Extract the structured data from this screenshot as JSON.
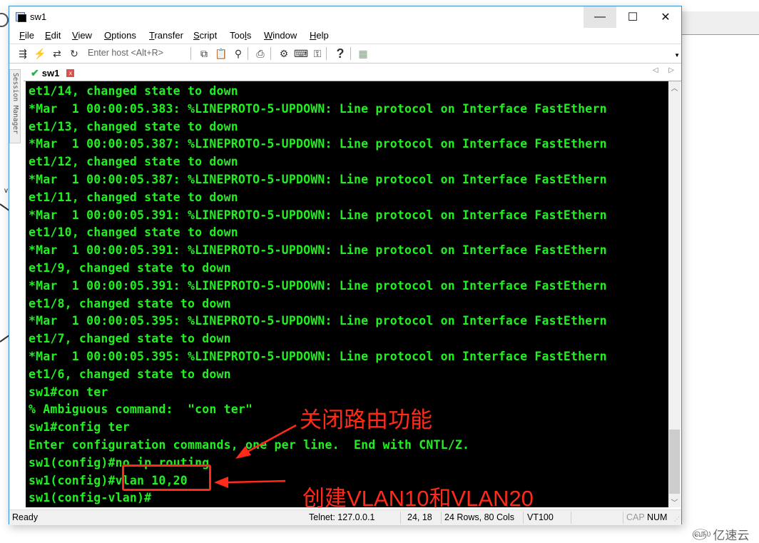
{
  "window": {
    "title": "sw1",
    "controls": {
      "minimize": "—",
      "maximize": "☐",
      "close": "✕"
    }
  },
  "menu": [
    {
      "label": "File",
      "accel": "F",
      "rest": "ile"
    },
    {
      "label": "Edit",
      "accel": "E",
      "rest": "dit"
    },
    {
      "label": "View",
      "accel": "V",
      "rest": "iew"
    },
    {
      "label": "Options",
      "accel": "O",
      "rest": "ptions"
    },
    {
      "label": "Transfer",
      "accel": "T",
      "rest": "ransfer"
    },
    {
      "label": "Script",
      "accel": "S",
      "rest": "cript"
    },
    {
      "label": "Tools",
      "pre": "Too",
      "accel": "l",
      "rest": "s"
    },
    {
      "label": "Window",
      "accel": "W",
      "rest": "indow"
    },
    {
      "label": "Help",
      "accel": "H",
      "rest": "elp"
    }
  ],
  "toolbar": {
    "host_placeholder": "Enter host <Alt+R>",
    "icons": {
      "connect": "⇶",
      "quick_connect": "⚡",
      "reconnect": "⇄",
      "disconnect": "↻",
      "copy": "⧉",
      "paste": "📋",
      "find": "⚲",
      "print": "⎙",
      "settings": "⚙",
      "keymap": "⌨",
      "key": "⚿",
      "help": "?",
      "sftp": "▦"
    }
  },
  "tabs": [
    {
      "label": "sw1",
      "status": "connected",
      "close": "x"
    }
  ],
  "tab_nav": "◁ ▷",
  "session_manager": "Session Manager",
  "terminal": {
    "lines": [
      "et1/14, changed state to down",
      "*Mar  1 00:00:05.383: %LINEPROTO-5-UPDOWN: Line protocol on Interface FastEthern",
      "et1/13, changed state to down",
      "*Mar  1 00:00:05.387: %LINEPROTO-5-UPDOWN: Line protocol on Interface FastEthern",
      "et1/12, changed state to down",
      "*Mar  1 00:00:05.387: %LINEPROTO-5-UPDOWN: Line protocol on Interface FastEthern",
      "et1/11, changed state to down",
      "*Mar  1 00:00:05.391: %LINEPROTO-5-UPDOWN: Line protocol on Interface FastEthern",
      "et1/10, changed state to down",
      "*Mar  1 00:00:05.391: %LINEPROTO-5-UPDOWN: Line protocol on Interface FastEthern",
      "et1/9, changed state to down",
      "*Mar  1 00:00:05.391: %LINEPROTO-5-UPDOWN: Line protocol on Interface FastEthern",
      "et1/8, changed state to down",
      "*Mar  1 00:00:05.395: %LINEPROTO-5-UPDOWN: Line protocol on Interface FastEthern",
      "et1/7, changed state to down",
      "*Mar  1 00:00:05.395: %LINEPROTO-5-UPDOWN: Line protocol on Interface FastEthern",
      "et1/6, changed state to down",
      "sw1#con ter",
      "% Ambiguous command:  \"con ter\"",
      "sw1#config ter",
      "Enter configuration commands, one per line.  End with CNTL/Z.",
      "sw1(config)#no ip routing",
      "sw1(config)#vlan 10,20",
      "sw1(config-vlan)#"
    ],
    "text_color": "#21f021",
    "background": "#000000",
    "scroll_position_fraction": 0.92
  },
  "annotations": {
    "label1": "关闭路由功能",
    "label2": "创建VLAN10和VLAN20",
    "color": "#ff2a1a"
  },
  "statusbar": {
    "status": "Ready",
    "connection": "Telnet: 127.0.0.1",
    "cursor": "24, 18",
    "size": "24 Rows, 80 Cols",
    "emulation": "VT100",
    "cap": "CAP",
    "num": "NUM"
  },
  "watermark": {
    "logo": "௵",
    "text": "亿速云"
  }
}
